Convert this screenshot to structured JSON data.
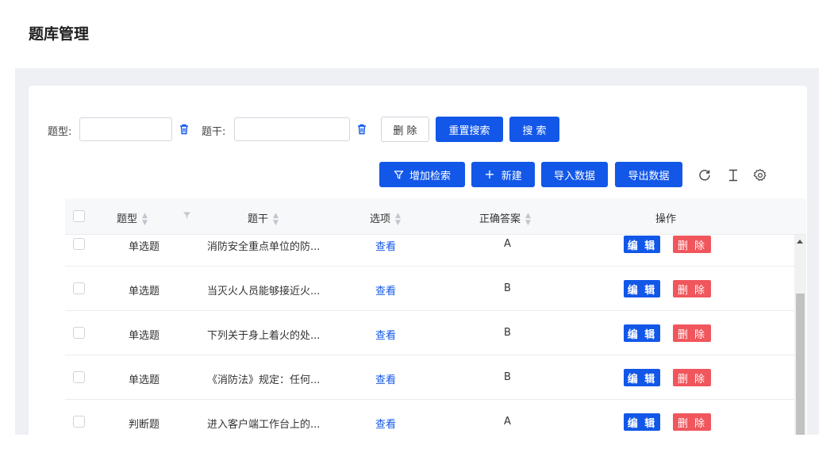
{
  "page": {
    "title": "题库管理"
  },
  "search": {
    "type_label": "题型:",
    "type_value": "",
    "stem_label": "题干:",
    "stem_value": "",
    "delete_label": "删 除",
    "reset_label": "重置搜索",
    "search_label": "搜 索"
  },
  "toolbar": {
    "add_filter_label": "增加检索",
    "new_label": "新建",
    "import_label": "导入数据",
    "export_label": "导出数据",
    "icons": [
      "refresh-icon",
      "column-height-icon",
      "settings-icon"
    ]
  },
  "table": {
    "columns": [
      "题型",
      "题干",
      "选项",
      "正确答案",
      "操作"
    ],
    "rows": [
      {
        "type": "单选题",
        "stem": "消防安全重点单位的防...",
        "options": "查看",
        "answer": "A",
        "edit": "编 辑",
        "delete": "删 除"
      },
      {
        "type": "单选题",
        "stem": "当灭火人员能够接近火...",
        "options": "查看",
        "answer": "B",
        "edit": "编 辑",
        "delete": "删 除"
      },
      {
        "type": "单选题",
        "stem": "下列关于身上着火的处...",
        "options": "查看",
        "answer": "B",
        "edit": "编 辑",
        "delete": "删 除"
      },
      {
        "type": "单选题",
        "stem": "《消防法》规定：任何...",
        "options": "查看",
        "answer": "B",
        "edit": "编 辑",
        "delete": "删 除"
      },
      {
        "type": "判断题",
        "stem": "进入客户端工作台上的...",
        "options": "查看",
        "answer": "A",
        "edit": "编 辑",
        "delete": "删 除"
      }
    ]
  },
  "colors": {
    "primary": "#1257e8",
    "danger": "#f0565c",
    "background": "#eef0f4"
  }
}
